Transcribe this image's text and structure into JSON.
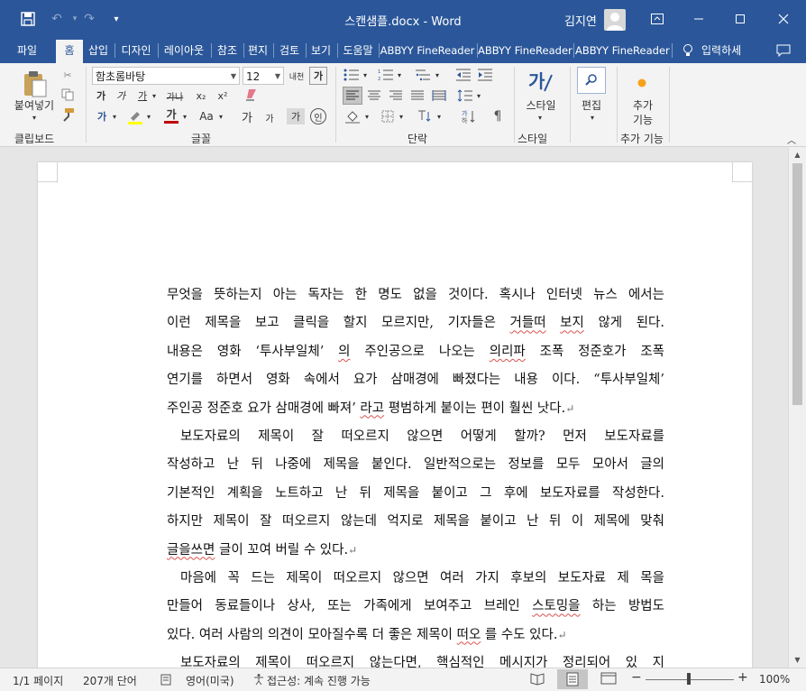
{
  "window": {
    "title": "스캔샘플.docx - Word",
    "user_name": "김지연",
    "qa": {
      "save": "save-icon",
      "undo": "undo-icon",
      "redo": "redo-icon",
      "customize": "chevron-down-icon"
    }
  },
  "tabs": [
    {
      "label": "파일"
    },
    {
      "label": "홈"
    },
    {
      "label": "삽입"
    },
    {
      "label": "디자인"
    },
    {
      "label": "레이아웃"
    },
    {
      "label": "참조"
    },
    {
      "label": "편지"
    },
    {
      "label": "검토"
    },
    {
      "label": "보기"
    },
    {
      "label": "도움말"
    },
    {
      "label": "ABBYY FineReader"
    },
    {
      "label": "ABBYY FineReader"
    },
    {
      "label": "ABBYY FineReader"
    }
  ],
  "tell_me": "입력하세",
  "ribbon": {
    "clipboard": {
      "paste_label": "붙여넣기",
      "group_label": "클립보드"
    },
    "font": {
      "font_name": "함초롬바탕",
      "font_size": "12",
      "group_label": "글꼴"
    },
    "paragraph": {
      "group_label": "단락"
    },
    "styles": {
      "styles_label": "스타일",
      "group_label": "스타일"
    },
    "editing": {
      "label": "편집"
    },
    "addins": {
      "label_line1": "추가",
      "label_line2": "기능",
      "group_label": "추가 기능"
    }
  },
  "document": {
    "lines": [
      "무엇을 뜻하는지 아는 독자는 한 명도 없을 것이다. 혹시나 인터넷 뉴스 에서는",
      "이런 제목을 보고 클릭을 할지 모르지만, 기자들은 거들떠 보지 않게 된다.",
      "내용은 영화 ‘투사부일체’ 의 주인공으로 나오는 의리파 조폭 정준호가 조폭",
      "연기를 하면서 영화 속에서 요가 삼매경에 빠졌다는 내용 이다. “투사부일체’",
      "주인공 정준호 요가 삼매경에 빠져’ 라고 평범하게 붙이는 편이 훨씬 낫다.",
      "보도자료의 제목이 잘 떠오르지 않으면 어떻게 할까? 먼저 보도자료를",
      "작성하고 난 뒤 나중에 제목을 붙인다. 일반적으로는 정보를 모두 모아서 글의",
      "기본적인 계획을 노트하고 난 뒤 제목을 붙이고 그 후에 보도자료를 작성한다.",
      "하지만 제목이 잘 떠오르지 않는데 억지로 제목을 붙이고 난 뒤 이 제목에 맞춰",
      "글을쓰면 글이 꼬여 버릴 수 있다.",
      "마음에 꼭 드는 제목이 떠오르지 않으면 여러 가지 후보의 보도자료 제 목을",
      "만들어 동료들이나 상사, 또는 가족에게 보여주고 브레인 스토밍을 하는 방법도",
      "있다. 여러 사람의 의견이 모아질수록 더 좋은 제목이 떠오 를 수도 있다.",
      "보도자료의 제목이 떠오르지 않는다면, 핵심적인 메시지가 정리되어 있 지"
    ],
    "paragraph_mark": "↵"
  },
  "status": {
    "page": "1/1 페이지",
    "words": "207개 단어",
    "language": "영어(미국)",
    "accessibility": "접근성: 계속 진행 가능",
    "zoom": "100%",
    "zoom_minus": "−",
    "zoom_plus": "+"
  },
  "colors": {
    "brand": "#2b579a",
    "ribbon_bg": "#f3f3f3",
    "font_color_bar": "#c00000",
    "highlight_bar": "#ffff00"
  }
}
